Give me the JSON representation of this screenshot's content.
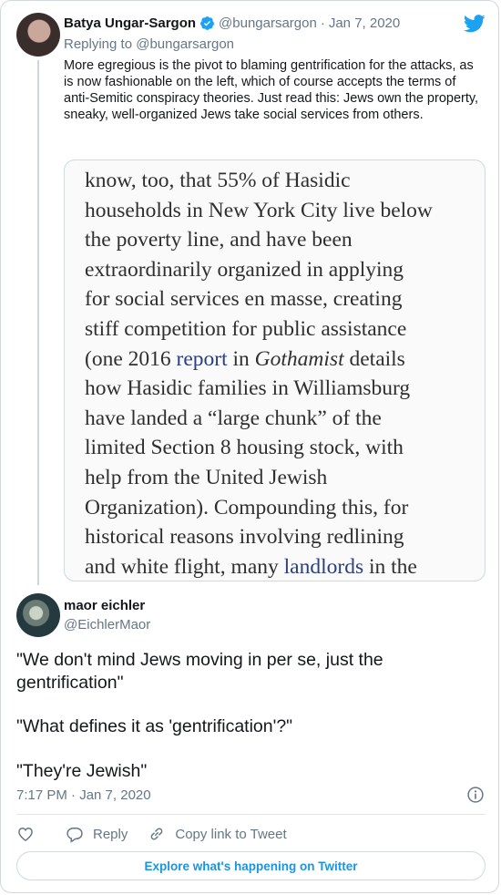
{
  "parent_tweet": {
    "author_name": "Batya Ungar-Sargon",
    "author_handle": "@bungarsargon",
    "separator": "·",
    "date": "Jan 7, 2020",
    "replying_prefix": "Replying to ",
    "replying_handle": "@bungarsargon",
    "text": "More egregious is the pivot to blaming gentrification for the attacks, as is now fashionable on the left, which of course accepts the terms of anti-Semitic conspiracy theories. Just read this: Jews own the property, sneaky, well-organized Jews take social services from others.",
    "quoted_image": {
      "l1": "know, too, that 55% of Hasidic",
      "l2": "households in New York City live below",
      "l3": "the poverty line, and have been",
      "l4": "extraordinarily organized in applying",
      "l5": "for social services en masse, creating",
      "l6": "stiff competition for public assistance",
      "l7a": "(one 2016 ",
      "l7_link": "report",
      "l7b": " in ",
      "l7_ital": "Gothamist",
      "l7c": " details",
      "l8": "how Hasidic families in Williamsburg",
      "l9": "have landed a “large chunk” of the",
      "l10": "limited Section 8 housing stock, with",
      "l11": "help from the United Jewish",
      "l12": "Organization). Compounding this, for",
      "l13": "historical reasons involving redlining",
      "l14a": "and white flight, many ",
      "l14_link": "landlords",
      "l14b": " in the"
    }
  },
  "main_tweet": {
    "author_name": "maor eichler",
    "author_handle": "@EichlerMaor",
    "para1": "\"We don't mind Jews moving in per se, just the gentrification\"",
    "para2": "\"What defines it as 'gentrification'?\"",
    "para3": "\"They're Jewish\"",
    "timestamp": "7:17 PM · Jan 7, 2020"
  },
  "actions": {
    "reply": "Reply",
    "copy_link": "Copy link to Tweet"
  },
  "explore_label": "Explore what's happening on Twitter",
  "colors": {
    "accent": "#1da1f2",
    "link": "#1b95e0",
    "muted": "#657786"
  },
  "icons": [
    "twitter-bird-icon",
    "verified-badge-icon",
    "info-icon",
    "heart-icon",
    "reply-icon",
    "link-icon"
  ]
}
